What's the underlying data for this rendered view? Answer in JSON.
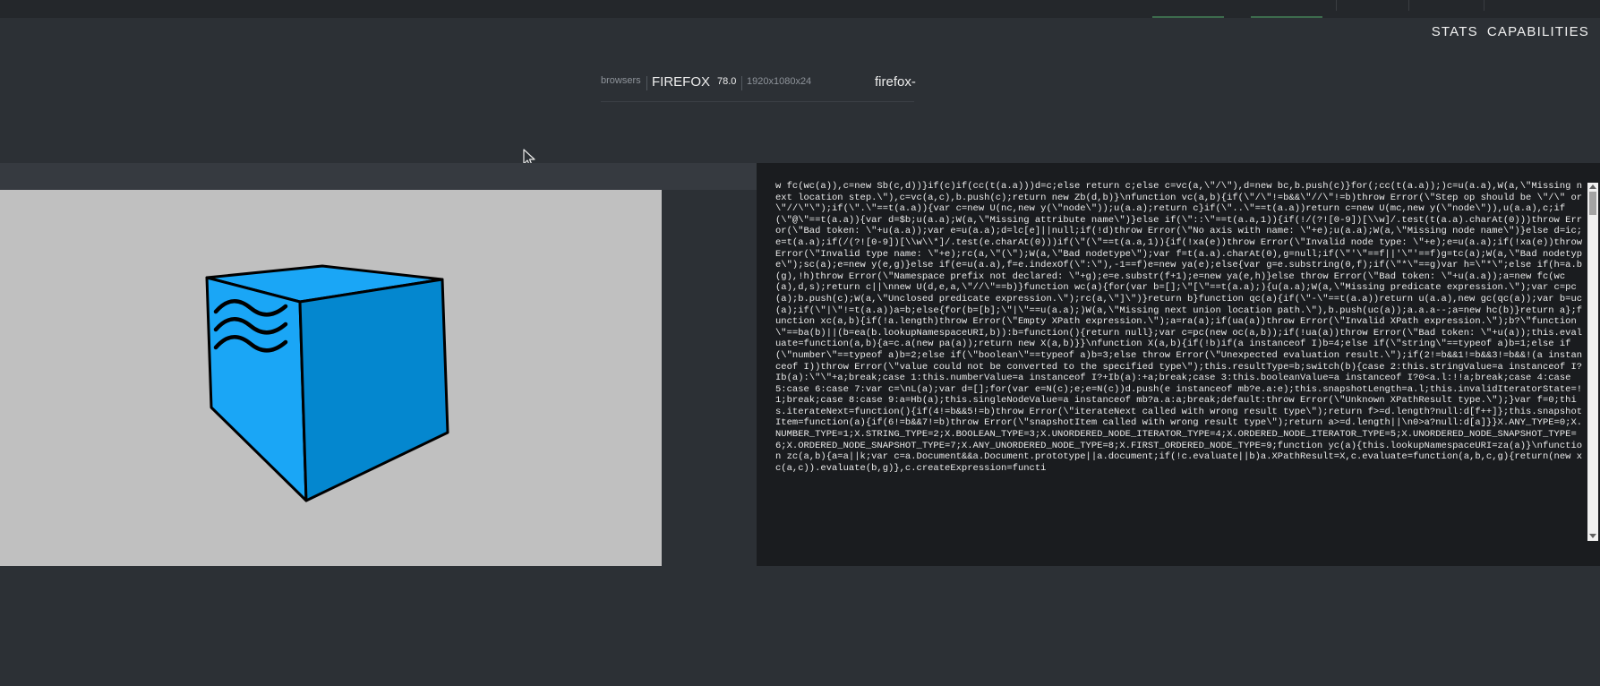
{
  "nav": {
    "stats": "STATS",
    "capabilities": "CAPABILITIES"
  },
  "session": {
    "label": "browsers",
    "browser": "FIREFOX",
    "version": "78.0",
    "resolution": "1920x1080x24",
    "name": "firefox-"
  },
  "colors": {
    "cube_face": "#1aa6f6",
    "cube_side": "#0487cf",
    "preview_bg": "#c0c0c0",
    "code_bg": "#1a1c1f"
  },
  "code": {
    "text": "w fc(wc(a)),c=new Sb(c,d))}if(c)if(cc(t(a.a)))d=c;else return c;else c=vc(a,\\\"/\\\"),d=new bc,b.push(c)}for(;cc(t(a.a));)c=u(a.a),W(a,\\\"Missing next location step.\\\"),c=vc(a,c),b.push(c);return new Zb(d,b)}\\nfunction vc(a,b){if(\\\"/\\\"!=b&&\\\"//\\\"!=b)throw Error(\\\"Step op should be \\\"/\\\" or \\\"//\\\"\\\");if(\\\".\\\"==t(a.a)){var c=new U(nc,new y(\\\"node\\\"));u(a.a);return c}if(\\\"..\\\"==t(a.a))return c=new U(mc,new y(\\\"node\\\")),u(a.a),c;if(\\\"@\\\"==t(a.a)){var d=$b;u(a.a);W(a,\\\"Missing attribute name\\\")}else if(\\\"::\\\"==t(a.a,1)){if(!/(?![0-9])[\\\\w]/.test(t(a.a).charAt(0)))throw Error(\\\"Bad token: \\\"+u(a.a));var e=u(a.a);d=lc[e]||null;if(!d)throw Error(\\\"No axis with name: \\\"+e);u(a.a);W(a,\\\"Missing node name\\\")}else d=ic;e=t(a.a);if(/(?![0-9])[\\\\w\\\\*]/.test(e.charAt(0)))if(\\\"(\\\"==t(a.a,1)){if(!xa(e))throw Error(\\\"Invalid node type: \\\"+e);e=u(a.a);if(!xa(e))throw Error(\\\"Invalid type name: \\\"+e);rc(a,\\\"(\\\");W(a,\\\"Bad nodetype\\\");var f=t(a.a).charAt(0),g=null;if(\\\"'\\\"==f||'\\\"'==f)g=tc(a);W(a,\\\"Bad nodetype\\\");sc(a);e=new y(e,g)}else if(e=u(a.a),f=e.indexOf(\\\":\\\"),-1==f)e=new ya(e);else{var g=e.substring(0,f);if(\\\"*\\\"==g)var h=\\\"*\\\";else if(h=a.b(g),!h)throw Error(\\\"Namespace prefix not declared: \\\"+g);e=e.substr(f+1);e=new ya(e,h)}else throw Error(\\\"Bad token: \\\"+u(a.a));a=new fc(wc(a),d,s);return c||\\nnew U(d,e,a,\\\"//\\\"==b)}function wc(a){for(var b=[];\\\"[\\\"==t(a.a);){u(a.a);W(a,\\\"Missing predicate expression.\\\");var c=pc(a);b.push(c);W(a,\\\"Unclosed predicate expression.\\\");rc(a,\\\"]\\\")}return b}function qc(a){if(\\\"-\\\"==t(a.a))return u(a.a),new gc(qc(a));var b=uc(a);if(\\\"|\\\"!=t(a.a))a=b;else{for(b=[b];\\\"|\\\"==u(a.a);)W(a,\\\"Missing next union location path.\\\"),b.push(uc(a));a.a.a--;a=new hc(b)}return a};function xc(a,b){if(!a.length)throw Error(\\\"Empty XPath expression.\\\");a=ra(a);if(ua(a))throw Error(\\\"Invalid XPath expression.\\\");b?\\\"function\\\"==ba(b)||(b=ea(b.lookupNamespaceURI,b)):b=function(){return null};var c=pc(new oc(a,b));if(!ua(a))throw Error(\\\"Bad token: \\\"+u(a));this.evaluate=function(a,b){a=c.a(new pa(a));return new X(a,b)}}\\nfunction X(a,b){if(!b)if(a instanceof I)b=4;else if(\\\"string\\\"==typeof a)b=1;else if(\\\"number\\\"==typeof a)b=2;else if(\\\"boolean\\\"==typeof a)b=3;else throw Error(\\\"Unexpected evaluation result.\\\");if(2!=b&&1!=b&&3!=b&&!(a instanceof I))throw Error(\\\"value could not be converted to the specified type\\\");this.resultType=b;switch(b){case 2:this.stringValue=a instanceof I?Ib(a):\\\"\\\"+a;break;case 1:this.numberValue=a instanceof I?+Ib(a):+a;break;case 3:this.booleanValue=a instanceof I?0<a.l:!!a;break;case 4:case 5:case 6:case 7:var c=\\nL(a);var d=[];for(var e=N(c);e;e=N(c))d.push(e instanceof mb?e.a:e);this.snapshotLength=a.l;this.invalidIteratorState=!1;break;case 8:case 9:a=Hb(a);this.singleNodeValue=a instanceof mb?a.a:a;break;default:throw Error(\\\"Unknown XPathResult type.\\\");}var f=0;this.iterateNext=function(){if(4!=b&&5!=b)throw Error(\\\"iterateNext called with wrong result type\\\");return f>=d.length?null:d[f++]};this.snapshotItem=function(a){if(6!=b&&7!=b)throw Error(\\\"snapshotItem called with wrong result type\\\");return a>=d.length||\\n0>a?null:d[a]}}X.ANY_TYPE=0;X.NUMBER_TYPE=1;X.STRING_TYPE=2;X.BOOLEAN_TYPE=3;X.UNORDERED_NODE_ITERATOR_TYPE=4;X.ORDERED_NODE_ITERATOR_TYPE=5;X.UNORDERED_NODE_SNAPSHOT_TYPE=6;X.ORDERED_NODE_SNAPSHOT_TYPE=7;X.ANY_UNORDERED_NODE_TYPE=8;X.FIRST_ORDERED_NODE_TYPE=9;function yc(a){this.lookupNamespaceURI=za(a)}\\nfunction zc(a,b){a=a||k;var c=a.Document&&a.Document.prototype||a.document;if(!c.evaluate||b)a.XPathResult=X,c.evaluate=function(a,b,c,g){return(new xc(a,c)).evaluate(b,g)},c.createExpression=functi"
  }
}
